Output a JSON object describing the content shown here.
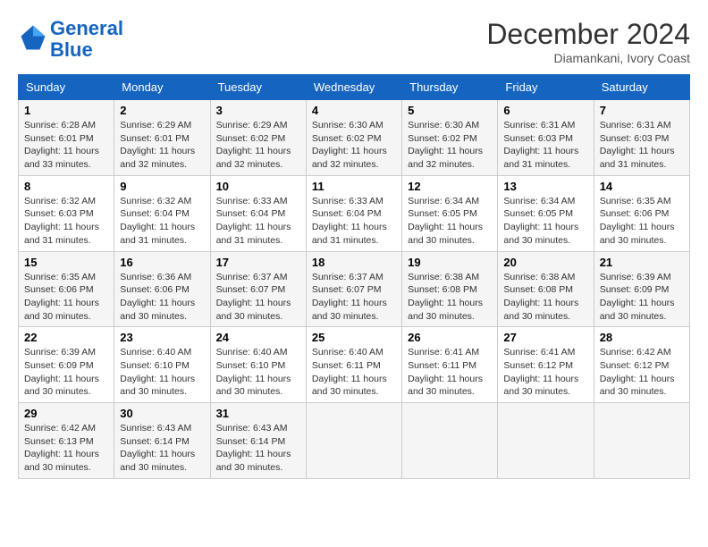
{
  "header": {
    "logo_line1": "General",
    "logo_line2": "Blue",
    "month": "December 2024",
    "location": "Diamankani, Ivory Coast"
  },
  "calendar": {
    "days_of_week": [
      "Sunday",
      "Monday",
      "Tuesday",
      "Wednesday",
      "Thursday",
      "Friday",
      "Saturday"
    ],
    "weeks": [
      [
        {
          "day": "",
          "info": ""
        },
        {
          "day": "2",
          "info": "Sunrise: 6:29 AM\nSunset: 6:01 PM\nDaylight: 11 hours\nand 32 minutes."
        },
        {
          "day": "3",
          "info": "Sunrise: 6:29 AM\nSunset: 6:02 PM\nDaylight: 11 hours\nand 32 minutes."
        },
        {
          "day": "4",
          "info": "Sunrise: 6:30 AM\nSunset: 6:02 PM\nDaylight: 11 hours\nand 32 minutes."
        },
        {
          "day": "5",
          "info": "Sunrise: 6:30 AM\nSunset: 6:02 PM\nDaylight: 11 hours\nand 32 minutes."
        },
        {
          "day": "6",
          "info": "Sunrise: 6:31 AM\nSunset: 6:03 PM\nDaylight: 11 hours\nand 31 minutes."
        },
        {
          "day": "7",
          "info": "Sunrise: 6:31 AM\nSunset: 6:03 PM\nDaylight: 11 hours\nand 31 minutes."
        }
      ],
      [
        {
          "day": "8",
          "info": "Sunrise: 6:32 AM\nSunset: 6:03 PM\nDaylight: 11 hours\nand 31 minutes."
        },
        {
          "day": "9",
          "info": "Sunrise: 6:32 AM\nSunset: 6:04 PM\nDaylight: 11 hours\nand 31 minutes."
        },
        {
          "day": "10",
          "info": "Sunrise: 6:33 AM\nSunset: 6:04 PM\nDaylight: 11 hours\nand 31 minutes."
        },
        {
          "day": "11",
          "info": "Sunrise: 6:33 AM\nSunset: 6:04 PM\nDaylight: 11 hours\nand 31 minutes."
        },
        {
          "day": "12",
          "info": "Sunrise: 6:34 AM\nSunset: 6:05 PM\nDaylight: 11 hours\nand 30 minutes."
        },
        {
          "day": "13",
          "info": "Sunrise: 6:34 AM\nSunset: 6:05 PM\nDaylight: 11 hours\nand 30 minutes."
        },
        {
          "day": "14",
          "info": "Sunrise: 6:35 AM\nSunset: 6:06 PM\nDaylight: 11 hours\nand 30 minutes."
        }
      ],
      [
        {
          "day": "15",
          "info": "Sunrise: 6:35 AM\nSunset: 6:06 PM\nDaylight: 11 hours\nand 30 minutes."
        },
        {
          "day": "16",
          "info": "Sunrise: 6:36 AM\nSunset: 6:06 PM\nDaylight: 11 hours\nand 30 minutes."
        },
        {
          "day": "17",
          "info": "Sunrise: 6:37 AM\nSunset: 6:07 PM\nDaylight: 11 hours\nand 30 minutes."
        },
        {
          "day": "18",
          "info": "Sunrise: 6:37 AM\nSunset: 6:07 PM\nDaylight: 11 hours\nand 30 minutes."
        },
        {
          "day": "19",
          "info": "Sunrise: 6:38 AM\nSunset: 6:08 PM\nDaylight: 11 hours\nand 30 minutes."
        },
        {
          "day": "20",
          "info": "Sunrise: 6:38 AM\nSunset: 6:08 PM\nDaylight: 11 hours\nand 30 minutes."
        },
        {
          "day": "21",
          "info": "Sunrise: 6:39 AM\nSunset: 6:09 PM\nDaylight: 11 hours\nand 30 minutes."
        }
      ],
      [
        {
          "day": "22",
          "info": "Sunrise: 6:39 AM\nSunset: 6:09 PM\nDaylight: 11 hours\nand 30 minutes."
        },
        {
          "day": "23",
          "info": "Sunrise: 6:40 AM\nSunset: 6:10 PM\nDaylight: 11 hours\nand 30 minutes."
        },
        {
          "day": "24",
          "info": "Sunrise: 6:40 AM\nSunset: 6:10 PM\nDaylight: 11 hours\nand 30 minutes."
        },
        {
          "day": "25",
          "info": "Sunrise: 6:40 AM\nSunset: 6:11 PM\nDaylight: 11 hours\nand 30 minutes."
        },
        {
          "day": "26",
          "info": "Sunrise: 6:41 AM\nSunset: 6:11 PM\nDaylight: 11 hours\nand 30 minutes."
        },
        {
          "day": "27",
          "info": "Sunrise: 6:41 AM\nSunset: 6:12 PM\nDaylight: 11 hours\nand 30 minutes."
        },
        {
          "day": "28",
          "info": "Sunrise: 6:42 AM\nSunset: 6:12 PM\nDaylight: 11 hours\nand 30 minutes."
        }
      ],
      [
        {
          "day": "29",
          "info": "Sunrise: 6:42 AM\nSunset: 6:13 PM\nDaylight: 11 hours\nand 30 minutes."
        },
        {
          "day": "30",
          "info": "Sunrise: 6:43 AM\nSunset: 6:14 PM\nDaylight: 11 hours\nand 30 minutes."
        },
        {
          "day": "31",
          "info": "Sunrise: 6:43 AM\nSunset: 6:14 PM\nDaylight: 11 hours\nand 30 minutes."
        },
        {
          "day": "",
          "info": ""
        },
        {
          "day": "",
          "info": ""
        },
        {
          "day": "",
          "info": ""
        },
        {
          "day": "",
          "info": ""
        }
      ]
    ],
    "first_week_day1": {
      "day": "1",
      "info": "Sunrise: 6:28 AM\nSunset: 6:01 PM\nDaylight: 11 hours\nand 33 minutes."
    }
  }
}
